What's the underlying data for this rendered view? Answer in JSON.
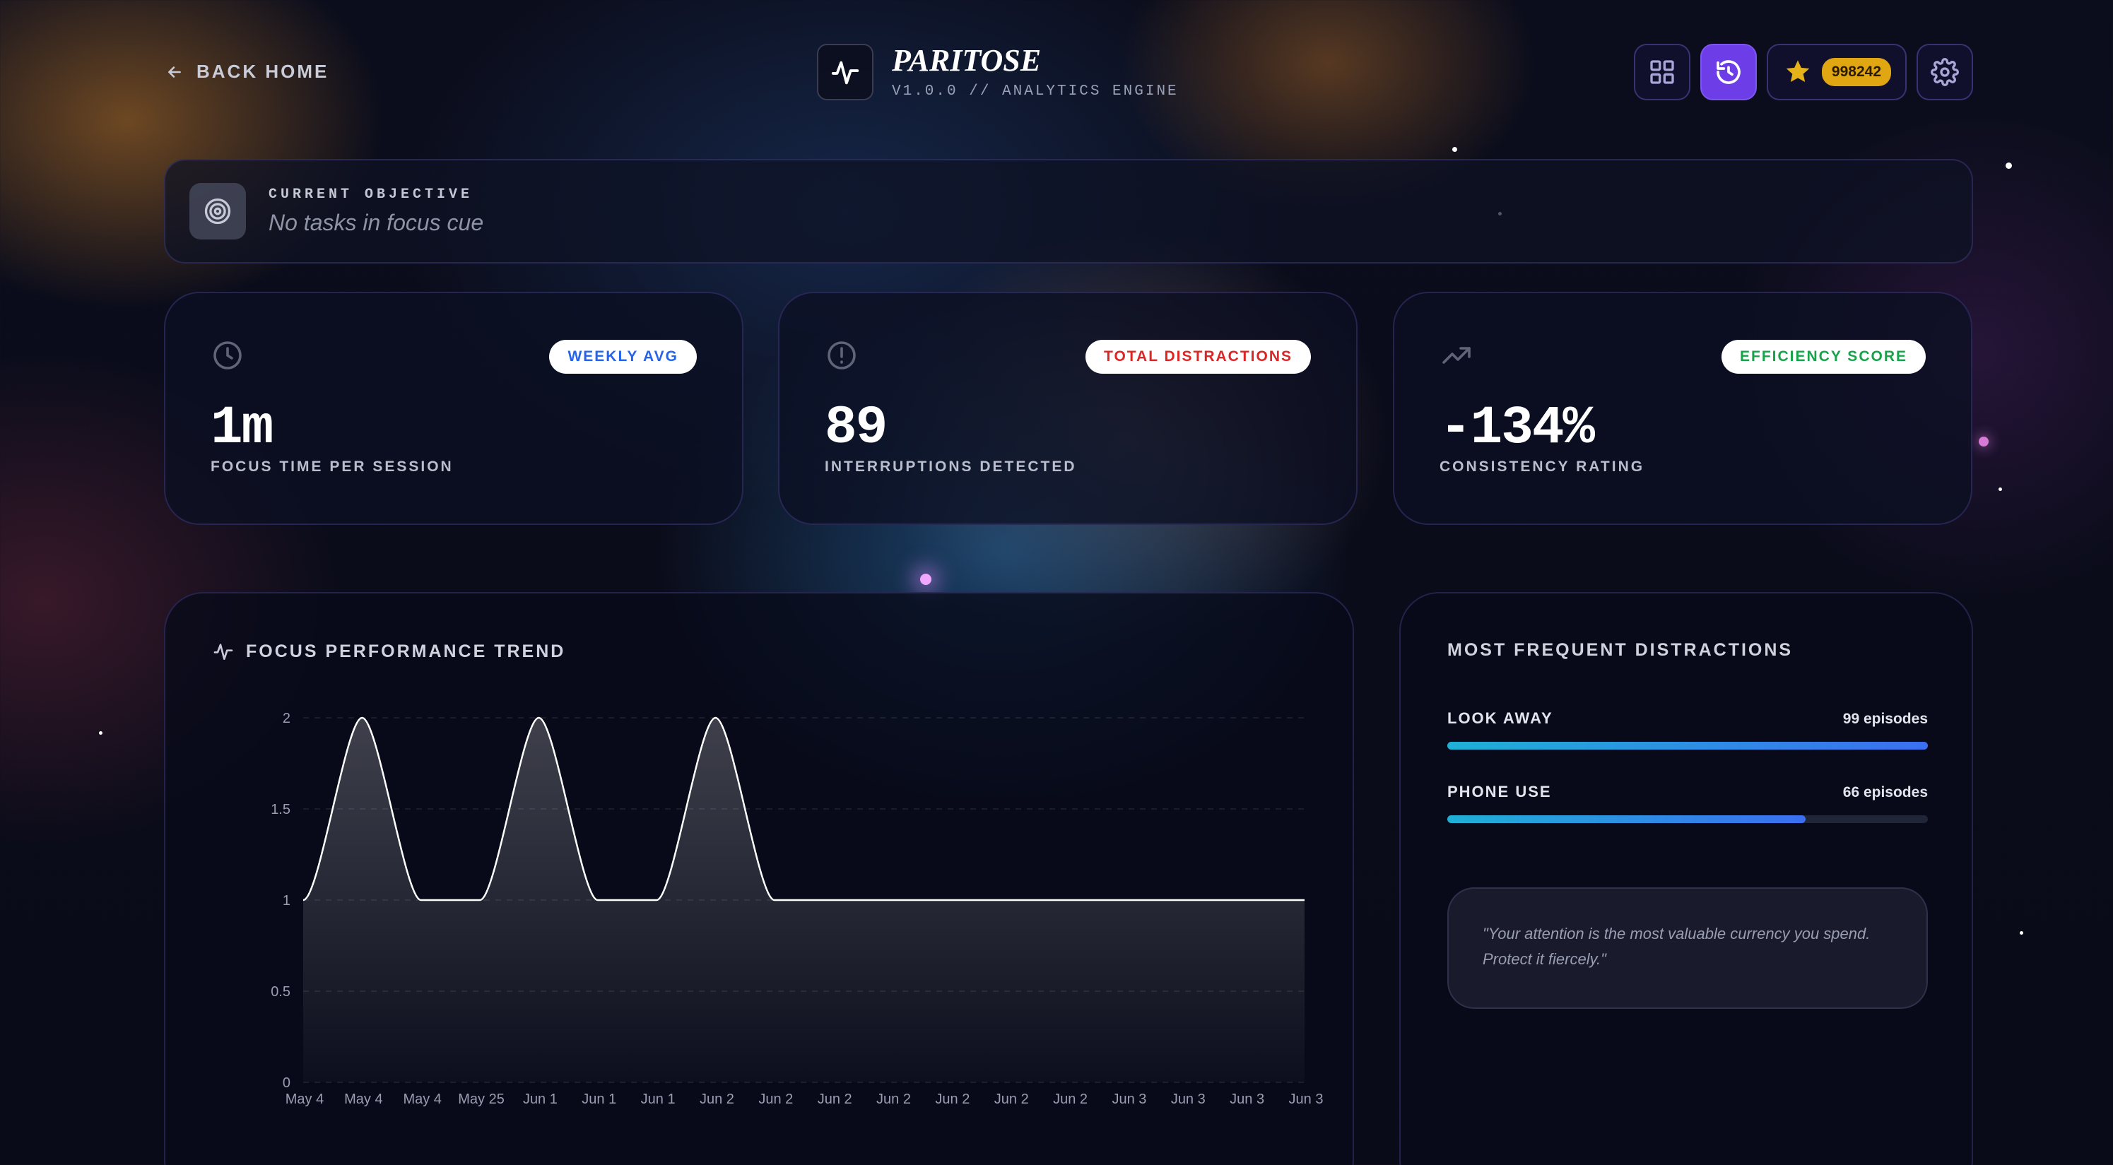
{
  "nav": {
    "back_label": "BACK HOME"
  },
  "brand": {
    "title": "PARITOSE",
    "subtitle": "V1.0.0 // ANALYTICS ENGINE"
  },
  "toolbar": {
    "points": "998242",
    "icons": [
      "grid-icon",
      "history-icon",
      "star-icon",
      "gear-icon"
    ]
  },
  "objective": {
    "label": "CURRENT OBJECTIVE",
    "text": "No tasks in focus cue"
  },
  "stats": [
    {
      "badge": "WEEKLY AVG",
      "badge_color": "#2563eb",
      "value": "1m",
      "label": "FOCUS TIME PER SESSION",
      "icon": "clock-icon"
    },
    {
      "badge": "TOTAL DISTRACTIONS",
      "badge_color": "#dc2626",
      "value": "89",
      "label": "INTERRUPTIONS DETECTED",
      "icon": "alert-icon"
    },
    {
      "badge": "EFFICIENCY SCORE",
      "badge_color": "#16a34a",
      "value": "-134%",
      "label": "CONSISTENCY RATING",
      "icon": "trend-up-icon"
    }
  ],
  "trend": {
    "title": "FOCUS PERFORMANCE TREND"
  },
  "chart_data": {
    "type": "area",
    "title": "FOCUS PERFORMANCE TREND",
    "categories": [
      "May 4",
      "May 4",
      "May 4",
      "May 25",
      "Jun 1",
      "Jun 1",
      "Jun 1",
      "Jun 2",
      "Jun 2",
      "Jun 2",
      "Jun 2",
      "Jun 2",
      "Jun 2",
      "Jun 2",
      "Jun 3",
      "Jun 3",
      "Jun 3",
      "Jun 3"
    ],
    "y_ticks": [
      0,
      0.5,
      1,
      1.5,
      2
    ],
    "ylim": [
      0,
      2
    ],
    "series": [
      {
        "values": [
          1,
          2,
          1,
          1,
          2,
          1,
          1,
          2,
          1,
          1,
          1,
          1,
          1,
          1,
          1,
          1,
          1,
          1
        ]
      }
    ],
    "grid": true
  },
  "distractions": {
    "title": "MOST FREQUENT DISTRACTIONS",
    "items": [
      {
        "name": "LOOK AWAY",
        "count": "99 episodes",
        "fraction": 1.0
      },
      {
        "name": "PHONE USE",
        "count": "66 episodes",
        "fraction": 0.745
      }
    ],
    "quote": "\"Your attention is the most valuable currency you spend. Protect it fiercely.\""
  },
  "colors": {
    "accent": "#6d3ee8",
    "points_gold": "#e0a712",
    "bar_start": "#1fb0d6",
    "bar_end": "#3b6ff0"
  }
}
